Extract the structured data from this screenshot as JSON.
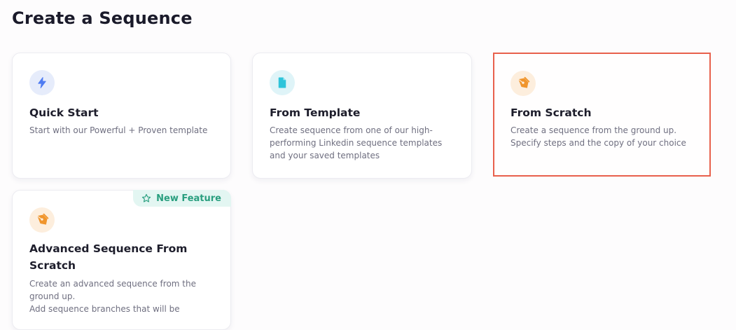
{
  "page_title": "Create a Sequence",
  "cards": [
    {
      "title": "Quick Start",
      "icon": "lightning-icon",
      "description": [
        "Start with our Powerful + Proven template"
      ]
    },
    {
      "title": "From Template",
      "icon": "document-icon",
      "description": [
        "Create sequence from one of our high-",
        "performing Linkedin sequence templates",
        "and your saved templates"
      ]
    },
    {
      "title": "From Scratch",
      "icon": "pen-nib-icon",
      "selected": true,
      "description": [
        "Create a sequence from the ground up.",
        "Specify steps and the copy of your choice"
      ]
    },
    {
      "title": "Advanced Sequence From Scratch",
      "icon": "pen-nib-icon",
      "badge": "New Feature",
      "description": [
        "Create an advanced sequence from the",
        "ground up.",
        "Add sequence branches that will be"
      ]
    }
  ],
  "colors": {
    "selected_border": "#e8604c",
    "lightning": "#4f7cf2",
    "document": "#2ec4da",
    "pen": "#f0952c",
    "new_feature": "#2a9f7f"
  }
}
